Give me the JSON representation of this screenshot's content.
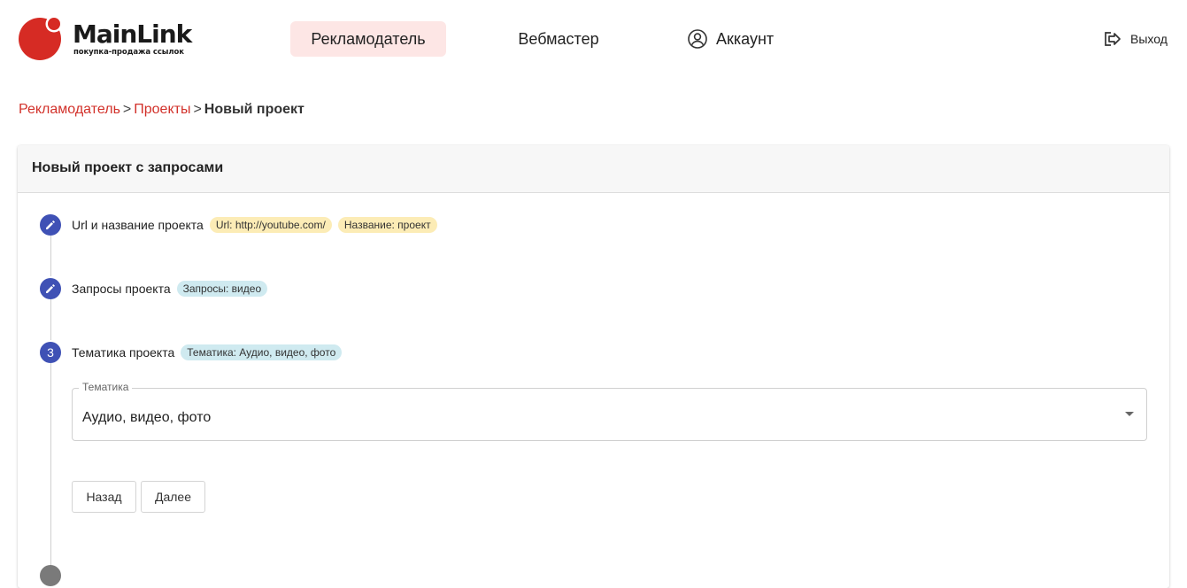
{
  "header": {
    "logo_title": "MainLink",
    "logo_subtitle": "покупка-продажа ссылок",
    "nav": {
      "advertiser": "Рекламодатель",
      "webmaster": "Вебмастер",
      "account": "Аккаунт"
    },
    "logout": "Выход"
  },
  "breadcrumb": {
    "items": [
      "Рекламодатель",
      "Проекты"
    ],
    "separator": ">",
    "current": "Новый проект"
  },
  "card": {
    "title": "Новый проект с запросами",
    "steps": [
      {
        "label": "Url и название проекта",
        "chips": [
          "Url: http://youtube.com/",
          "Название: проект"
        ]
      },
      {
        "label": "Запросы проекта",
        "chips": [
          "Запросы: видео"
        ]
      },
      {
        "number": "3",
        "label": "Тематика проекта",
        "chips": [
          "Тематика: Аудио, видео, фото"
        ]
      }
    ],
    "topic_select": {
      "legend": "Тематика",
      "value": "Аудио, видео, фото"
    },
    "buttons": {
      "back": "Назад",
      "next": "Далее"
    }
  },
  "colors": {
    "brand_red": "#d2312a",
    "step_blue": "#3f51b5",
    "nav_active_bg": "#fde6e5",
    "chip_yellow": "#fcecb6",
    "chip_blue": "#cfeaf0"
  }
}
